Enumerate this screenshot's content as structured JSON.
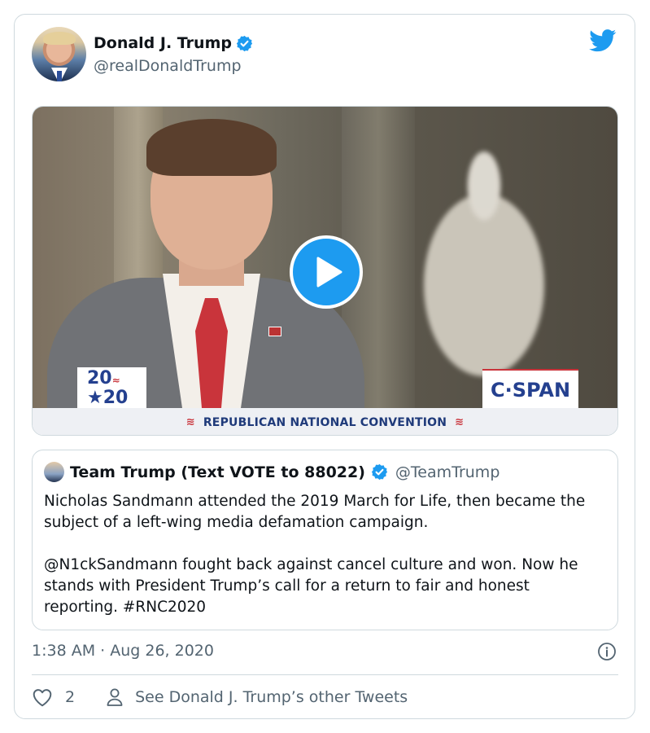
{
  "tweet": {
    "author_name": "Donald J. Trump",
    "author_handle": "@realDonaldTrump",
    "timestamp": "1:38 AM · Aug 26, 2020",
    "like_count": "2",
    "other_tweets_link": "See Donald J. Trump’s other Tweets"
  },
  "video": {
    "logo_2020_top": "20",
    "logo_2020_bottom": "★20",
    "network_logo": "C·SPAN",
    "banner_text": "REPUBLICAN NATIONAL CONVENTION"
  },
  "quoted_tweet": {
    "author_name": "Team Trump (Text VOTE to 88022)",
    "author_handle": "@TeamTrump",
    "paragraph_1": "Nicholas Sandmann attended the 2019 March for Life, then became the subject of a left-wing media defamation campaign.",
    "paragraph_2": "@N1ckSandmann fought back against cancel culture and won. Now he stands with President Trump’s call for a return to fair and honest reporting. #RNC2020"
  },
  "icons": {
    "verified": "verified-badge-icon",
    "brand": "twitter-bird-icon",
    "play": "play-icon",
    "info": "info-icon",
    "like": "heart-icon",
    "profile": "person-icon"
  },
  "colors": {
    "accent": "#1d9bf0",
    "text_secondary": "#536471",
    "border": "#cfd9de"
  }
}
